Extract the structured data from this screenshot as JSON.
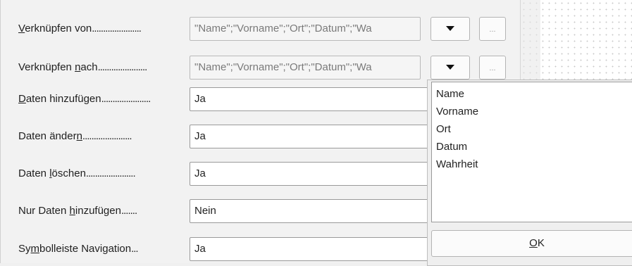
{
  "form": {
    "rows": [
      {
        "label_pre": "",
        "label_key": "V",
        "label_post": "erknüpfen von",
        "value": "\"Name\";\"Vorname\";\"Ort\";\"Datum\";\"Wa"
      },
      {
        "label_pre": "Verknüpfen ",
        "label_key": "n",
        "label_post": "ach",
        "value": "\"Name\";\"Vorname\";\"Ort\";\"Datum\";\"Wa"
      },
      {
        "label_pre": "",
        "label_key": "D",
        "label_post": "aten hinzufügen",
        "value": "Ja"
      },
      {
        "label_pre": "Daten änder",
        "label_key": "n",
        "label_post": "",
        "value": "Ja"
      },
      {
        "label_pre": "Daten ",
        "label_key": "l",
        "label_post": "öschen",
        "value": "Ja"
      },
      {
        "label_pre": "Nur Daten ",
        "label_key": "h",
        "label_post": "inzufügen",
        "value": "Nein"
      },
      {
        "label_pre": "Sy",
        "label_key": "m",
        "label_post": "bolleiste Navigation",
        "value": "Ja"
      }
    ],
    "dots_long": "......................",
    "dots_short": ".......",
    "browse_label": "..."
  },
  "field_list_popup": {
    "items": [
      "Name",
      "Vorname",
      "Ort",
      "Datum",
      "Wahrheit"
    ],
    "ok_key": "O",
    "ok_rest": "K"
  }
}
